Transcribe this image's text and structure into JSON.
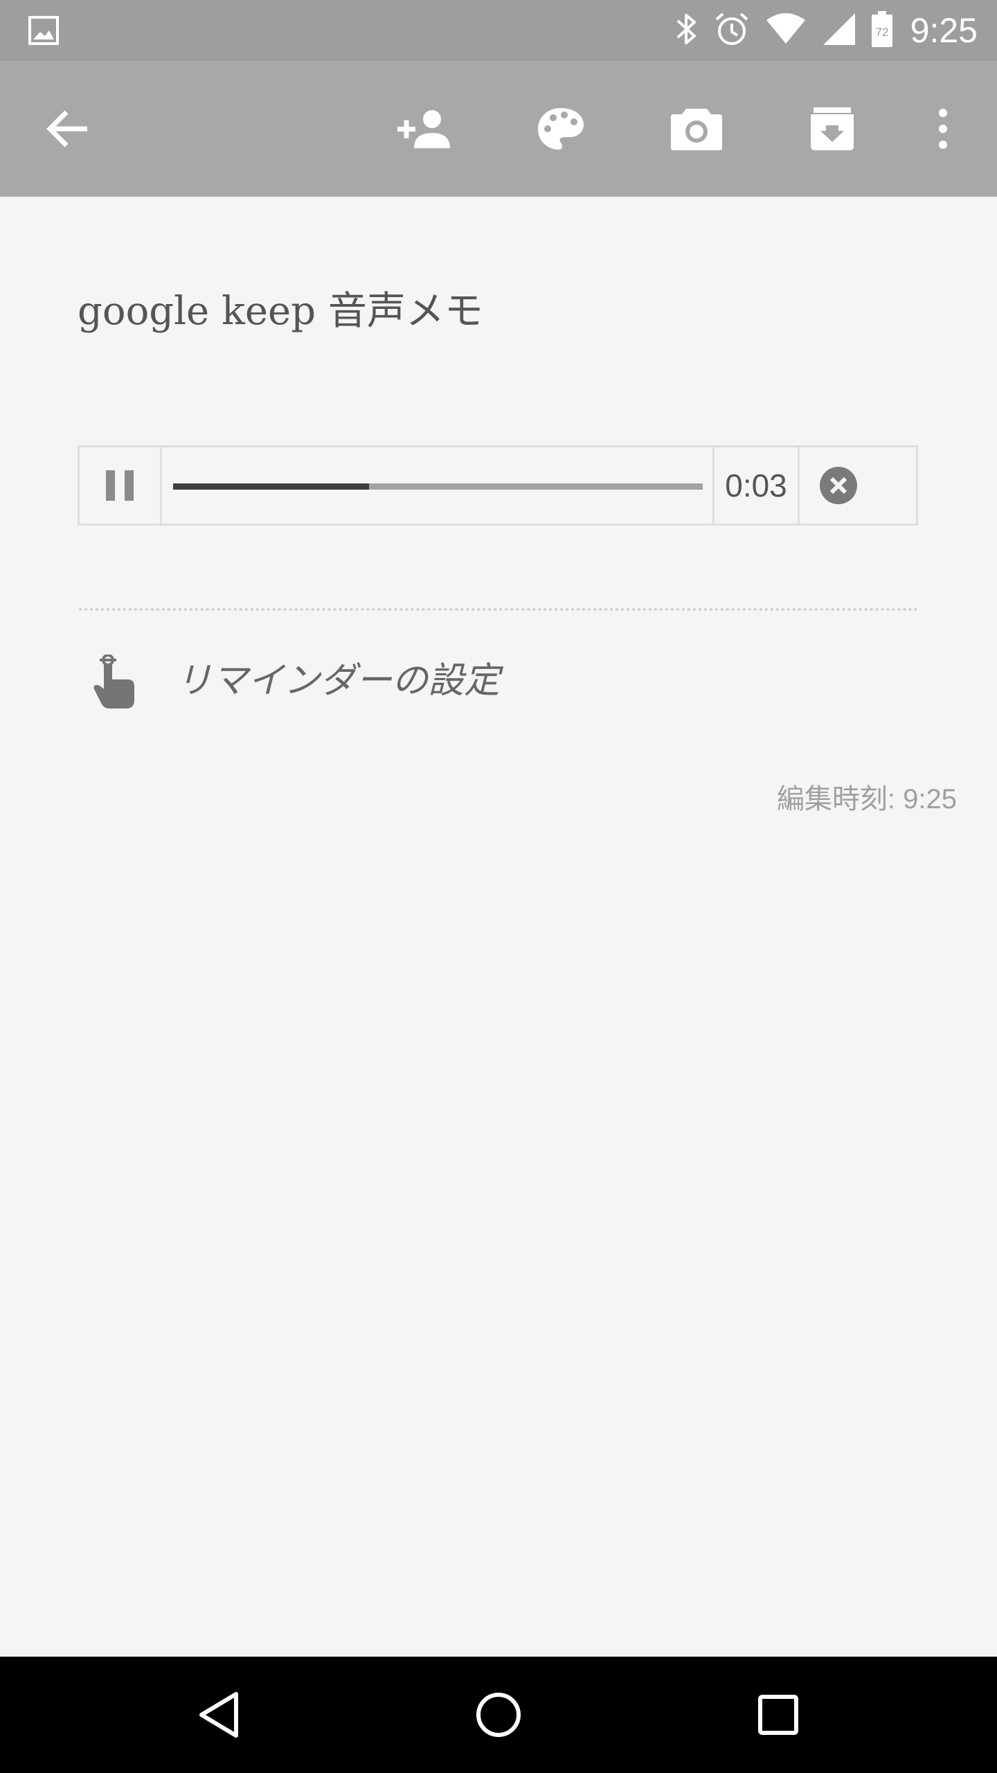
{
  "status_bar": {
    "time": "9:25",
    "battery_level": "72",
    "icons": [
      "image-icon",
      "bluetooth-icon",
      "alarm-icon",
      "wifi-icon",
      "signal-icon",
      "battery-icon"
    ]
  },
  "toolbar": {
    "icons": [
      "back-arrow-icon",
      "add-person-icon",
      "palette-icon",
      "camera-icon",
      "archive-icon",
      "more-vert-icon"
    ]
  },
  "note": {
    "title": "google keep 音声メモ"
  },
  "audio_player": {
    "elapsed": "0:03",
    "progress": 0.37,
    "state": "playing"
  },
  "reminder": {
    "label": "リマインダーの設定"
  },
  "edited": {
    "label": "編集時刻: 9:25"
  },
  "colors": {
    "status_bar": "#9e9e9e",
    "toolbar": "#a8a8a8",
    "background": "#f5f5f5",
    "nav_bar": "#000000"
  },
  "nav_bar": {
    "icons": [
      "nav-back-icon",
      "nav-home-icon",
      "nav-recents-icon"
    ]
  }
}
